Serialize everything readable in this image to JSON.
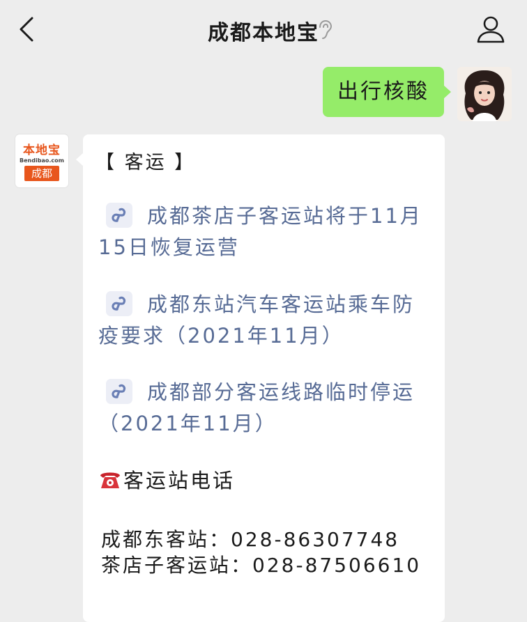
{
  "header": {
    "title": "成都本地宝",
    "back_icon": "chevron-left-icon",
    "ear_icon": "ear-icon",
    "profile_icon": "person-icon"
  },
  "user_message": {
    "text": "出行核酸",
    "bubble_color": "#95ec69"
  },
  "bot": {
    "avatar": {
      "brand": "本地宝",
      "url": "Bendibao.com",
      "city": "成都",
      "brand_color": "#e8561c"
    },
    "section_title": "【 客运 】",
    "link_color": "#576b95",
    "links": [
      {
        "icon": "mini-program-link-icon",
        "text": "成都茶店子客运站将于11月15日恢复运营"
      },
      {
        "icon": "mini-program-link-icon",
        "text": "成都东站汽车客运站乘车防疫要求（2021年11月）"
      },
      {
        "icon": "mini-program-link-icon",
        "text": "成都部分客运线路临时停运（2021年11月）"
      }
    ],
    "phone_section": {
      "icon": "telephone-icon",
      "title": "客运站电话"
    },
    "phones": [
      {
        "label": "成都东客站：",
        "number": "028-86307748"
      },
      {
        "label": "茶店子客运站：",
        "number": "028-87506610"
      }
    ]
  }
}
